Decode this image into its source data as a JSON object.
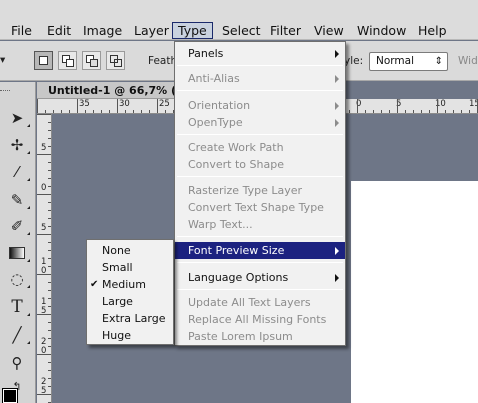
{
  "menubar": {
    "items": [
      "File",
      "Edit",
      "Image",
      "Layer",
      "Type",
      "Select",
      "Filter",
      "View",
      "Window",
      "Help"
    ],
    "active": "Type"
  },
  "options_bar": {
    "feather_label": "Feath",
    "style_label": "yle:",
    "style_value": "Normal",
    "width_label": "Wid"
  },
  "document": {
    "tab_title": "Untitled-1 @ 66,7% (CM",
    "ruler_h_labels": [
      "35",
      "30",
      "25",
      "0",
      "5",
      "10",
      "15"
    ],
    "ruler_v_labels": [
      "5",
      "0",
      "5",
      "10",
      "15",
      "20",
      "25"
    ]
  },
  "type_menu": {
    "items": [
      {
        "label": "Panels",
        "submenu": true,
        "disabled": false
      },
      {
        "label": "Anti-Alias",
        "submenu": true,
        "disabled": true
      },
      {
        "label": "Orientation",
        "submenu": true,
        "disabled": true
      },
      {
        "label": "OpenType",
        "submenu": true,
        "disabled": true
      },
      {
        "label": "Create Work Path",
        "submenu": false,
        "disabled": true
      },
      {
        "label": "Convert to Shape",
        "submenu": false,
        "disabled": true
      },
      {
        "label": "Rasterize Type Layer",
        "submenu": false,
        "disabled": true
      },
      {
        "label": "Convert Text Shape Type",
        "submenu": false,
        "disabled": true
      },
      {
        "label": "Warp Text...",
        "submenu": false,
        "disabled": true
      },
      {
        "label": "Font Preview Size",
        "submenu": true,
        "disabled": false,
        "highlighted": true
      },
      {
        "label": "Language Options",
        "submenu": true,
        "disabled": false
      },
      {
        "label": "Update All Text Layers",
        "submenu": false,
        "disabled": true
      },
      {
        "label": "Replace All Missing Fonts",
        "submenu": false,
        "disabled": true
      },
      {
        "label": "Paste Lorem Ipsum",
        "submenu": false,
        "disabled": true
      }
    ]
  },
  "font_preview_submenu": {
    "items": [
      "None",
      "Small",
      "Medium",
      "Large",
      "Extra Large",
      "Huge"
    ],
    "checked": "Medium"
  },
  "icons": {
    "tools": [
      "move-icon",
      "quick-select-icon",
      "eyedropper-icon",
      "brush-icon",
      "history-brush-icon",
      "gradient-icon",
      "lasso-icon",
      "type-icon",
      "line-icon",
      "zoom-icon",
      "swap-colors-icon",
      "color-swatch-icon"
    ]
  },
  "colors": {
    "menu_highlight": "#1c2280",
    "canvas_bg": "#6e7687",
    "menu_bg": "#f1f1f1"
  }
}
